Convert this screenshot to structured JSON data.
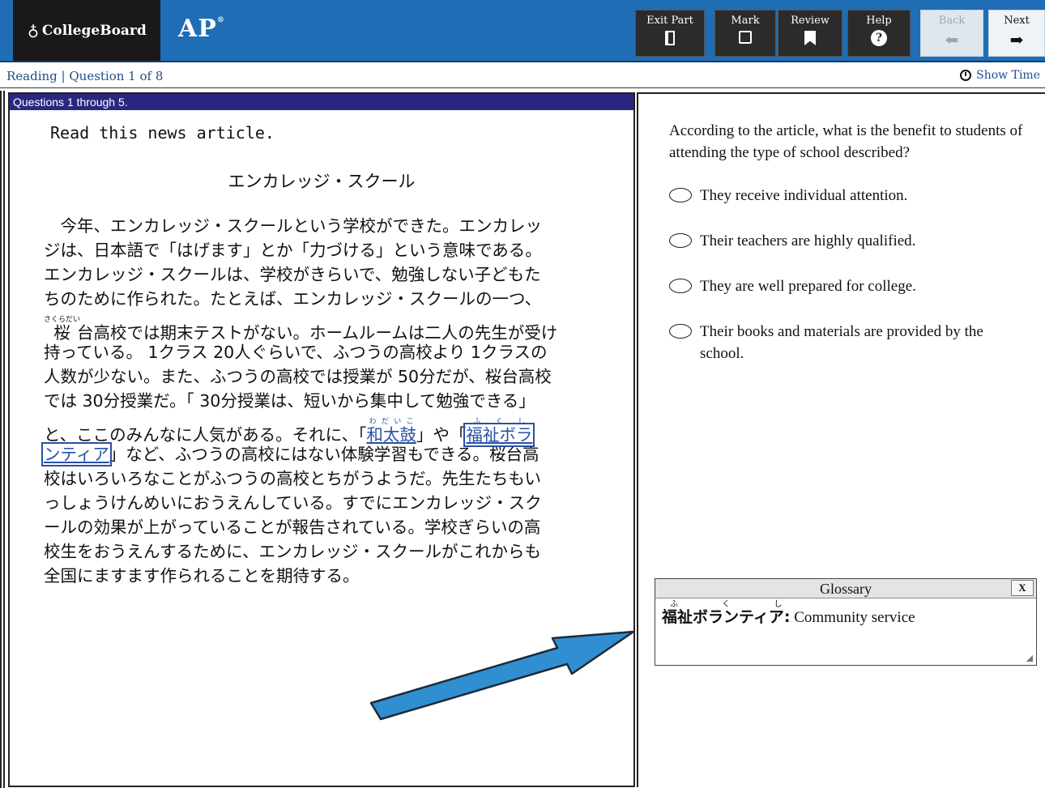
{
  "header": {
    "brand": "CollegeBoard",
    "product": "AP",
    "buttons": {
      "exit_part": "Exit Part",
      "mark": "Mark",
      "review": "Review",
      "help": "Help",
      "back": "Back",
      "next": "Next"
    }
  },
  "status": {
    "breadcrumb": "Reading | Question 1 of 8",
    "show_time": "Show Time"
  },
  "passage": {
    "range": "Questions 1 through 5.",
    "instruction": "Read this news article.",
    "title": "エンカレッジ・スクール",
    "lines": [
      "　今年、エンカレッジ・スクールという学校ができた。エンカレッ",
      "ジは、日本語で「はげます」とか「力づける」という意味である。",
      "エンカレッジ・スクールは、学校がきらいで、勉強しない子どもた",
      "ちのために作られた。たとえば、エンカレッジ・スクールの一つ、",
      "台高校では期末テストがない。ホームルームは二人の先生が受け",
      "持っている。 1クラス 20人ぐらいで、ふつうの高校より 1クラスの",
      "人数が少ない。また、ふつうの高校では授業が 50分だが、桜台高校",
      "では 30分授業だ。「 30分授業は、短いから集中して勉強できる」",
      "と、ここのみんなに人気がある。それに、「",
      "」や「",
      "」など、ふつうの高校にはない体験学習もできる。桜台高",
      "校はいろいろなことがふつうの高校とちがうようだ。先生たちもい",
      "っしょうけんめいにおうえんしている。すでにエンカレッジ・スク",
      "ールの効果が上がっていることが報告されている。学校ぎらいの高",
      "校生をおうえんするために、エンカレッジ・スクールがこれからも",
      "全国にますます作られることを期待する。"
    ],
    "sakura_kanji": "桜",
    "sakura_ruby": "さくらだい",
    "wadaiko": "和太鼓",
    "wadaiko_ruby": "わだいこ",
    "fukushi_part1": "福祉ボラ",
    "fukushi_ruby": "ふくし",
    "fukushi_part2": "ンティア"
  },
  "question": {
    "prompt": "According to the article, what is the benefit to students of attending the type of school described?",
    "options": [
      "They receive individual attention.",
      "Their teachers are highly qualified.",
      "They are well prepared for college.",
      "Their books and materials are provided by the school."
    ]
  },
  "glossary": {
    "title": "Glossary",
    "close": "X",
    "term_ruby": "ふくし",
    "term": "福祉ボランティア:",
    "definition": " Community service"
  },
  "colors": {
    "header_blue": "#1f6db5",
    "brand_black": "#1a1818",
    "question_bar": "#2a2781",
    "link_blue": "#2a4fa8",
    "arrow_blue": "#2f8fd0"
  }
}
